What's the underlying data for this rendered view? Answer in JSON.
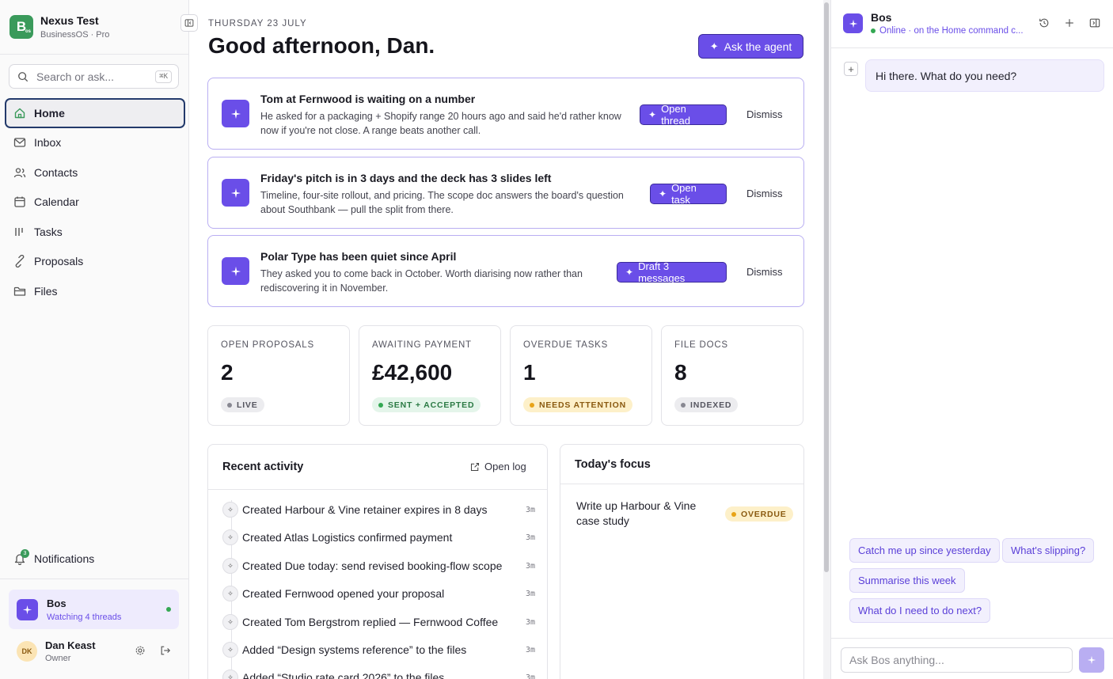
{
  "workspace": {
    "name": "Nexus Test",
    "plan": "BusinessOS · Pro",
    "logo_letter": "B",
    "logo_sub": "os"
  },
  "search": {
    "placeholder": "Search or ask...",
    "shortcut": "⌘K"
  },
  "nav": [
    {
      "label": "Home",
      "icon": "home-icon"
    },
    {
      "label": "Inbox",
      "icon": "mail-icon"
    },
    {
      "label": "Contacts",
      "icon": "users-icon"
    },
    {
      "label": "Calendar",
      "icon": "calendar-icon"
    },
    {
      "label": "Tasks",
      "icon": "tasks-icon"
    },
    {
      "label": "Proposals",
      "icon": "proposals-icon"
    },
    {
      "label": "Files",
      "icon": "folder-icon"
    }
  ],
  "notifications": {
    "label": "Notifications",
    "count": "3"
  },
  "bos_card": {
    "name": "Bos",
    "status": "Watching 4 threads"
  },
  "user": {
    "initials": "DK",
    "name": "Dan Keast",
    "role": "Owner"
  },
  "header": {
    "date": "THURSDAY 23 JULY",
    "greeting": "Good afternoon, Dan.",
    "ask_label": "Ask the agent"
  },
  "alerts": [
    {
      "title": "Tom at Fernwood is waiting on a number",
      "body": "He asked for a packaging + Shopify range 20 hours ago and said he'd rather know now if you're not close. A range beats another call.",
      "action": "Open thread",
      "dismiss": "Dismiss"
    },
    {
      "title": "Friday's pitch is in 3 days and the deck has 3 slides left",
      "body": "Timeline, four-site rollout, and pricing. The scope doc answers the board's question about Southbank — pull the split from there.",
      "action": "Open task",
      "dismiss": "Dismiss"
    },
    {
      "title": "Polar Type has been quiet since April",
      "body": "They asked you to come back in October. Worth diarising now rather than rediscovering it in November.",
      "action": "Draft 3 messages",
      "dismiss": "Dismiss"
    }
  ],
  "stats": [
    {
      "label": "OPEN PROPOSALS",
      "value": "2",
      "pill": "LIVE",
      "tone": "grey"
    },
    {
      "label": "AWAITING PAYMENT",
      "value": "£42,600",
      "pill": "SENT + ACCEPTED",
      "tone": "green"
    },
    {
      "label": "OVERDUE TASKS",
      "value": "1",
      "pill": "NEEDS ATTENTION",
      "tone": "amber"
    },
    {
      "label": "FILE DOCS",
      "value": "8",
      "pill": "INDEXED",
      "tone": "grey"
    }
  ],
  "activity": {
    "title": "Recent activity",
    "open_log": "Open log",
    "items": [
      {
        "text": "Created Harbour & Vine retainer expires in 8 days",
        "time": "3m"
      },
      {
        "text": "Created Atlas Logistics confirmed payment",
        "time": "3m"
      },
      {
        "text": "Created Due today: send revised booking-flow scope",
        "time": "3m"
      },
      {
        "text": "Created Fernwood opened your proposal",
        "time": "3m"
      },
      {
        "text": "Created Tom Bergstrom replied — Fernwood Coffee",
        "time": "3m"
      },
      {
        "text": "Added “Design systems reference” to the files",
        "time": "3m"
      },
      {
        "text": "Added “Studio rate card 2026” to the files",
        "time": "3m"
      }
    ]
  },
  "focus": {
    "title": "Today's focus",
    "item": "Write up Harbour & Vine case study",
    "badge": "OVERDUE"
  },
  "agent": {
    "name": "Bos",
    "status": "Online · on the Home command c...",
    "greeting": "Hi there. What do you need?",
    "chips": [
      "Catch me up since yesterday",
      "What's slipping?",
      "Summarise this week",
      "What do I need to do next?"
    ],
    "input_placeholder": "Ask Bos anything..."
  },
  "colors": {
    "accent": "#6a4ee8",
    "brand": "#3a9a5b",
    "online": "#34a853"
  }
}
